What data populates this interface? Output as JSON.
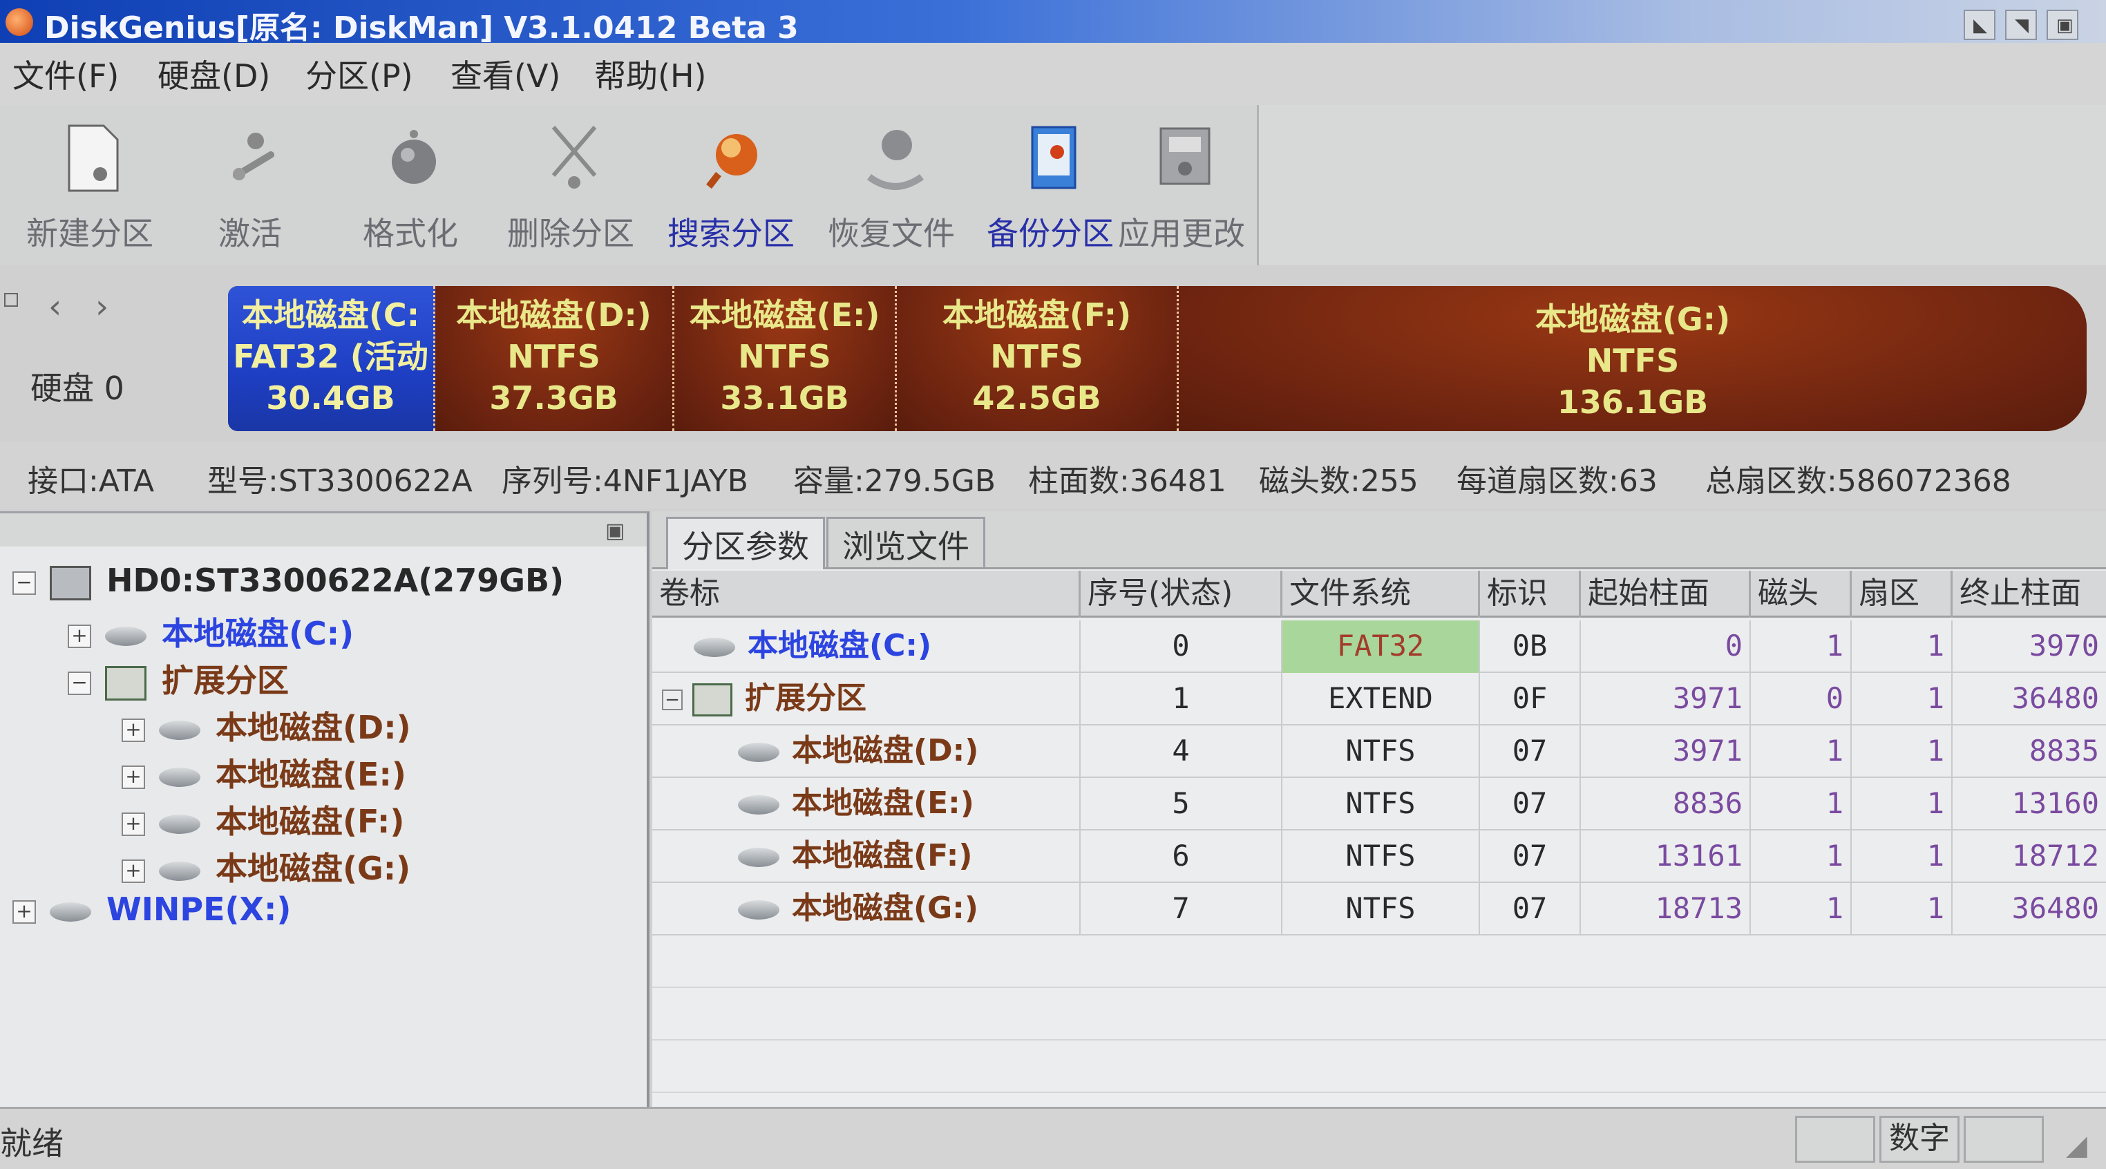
{
  "window": {
    "title": "DiskGenius[原名: DiskMan] V3.1.0412 Beta 3"
  },
  "menu": [
    "文件(F)",
    "硬盘(D)",
    "分区(P)",
    "查看(V)",
    "帮助(H)"
  ],
  "toolbar": [
    {
      "label": "新建分区",
      "icon": "new-partition-icon"
    },
    {
      "label": "激活",
      "icon": "activate-icon"
    },
    {
      "label": "格式化",
      "icon": "format-icon"
    },
    {
      "label": "删除分区",
      "icon": "delete-partition-icon"
    },
    {
      "label": "搜索分区",
      "icon": "search-partition-icon"
    },
    {
      "label": "恢复文件",
      "icon": "recover-files-icon"
    },
    {
      "label": "备份分区",
      "icon": "backup-partition-icon"
    },
    {
      "label": "应用更改",
      "icon": "apply-changes-icon"
    }
  ],
  "diskbar": {
    "disk_label": "硬盘 0",
    "partitions": [
      {
        "name": "本地磁盘(C:",
        "fs": "FAT32 (活动",
        "size": "30.4GB"
      },
      {
        "name": "本地磁盘(D:)",
        "fs": "NTFS",
        "size": "37.3GB"
      },
      {
        "name": "本地磁盘(E:)",
        "fs": "NTFS",
        "size": "33.1GB"
      },
      {
        "name": "本地磁盘(F:)",
        "fs": "NTFS",
        "size": "42.5GB"
      },
      {
        "name": "本地磁盘(G:)",
        "fs": "NTFS",
        "size": "136.1GB"
      }
    ]
  },
  "diskinfo": {
    "interface": "接口:ATA",
    "model": "型号:ST3300622A",
    "serial": "序列号:4NF1JAYB",
    "capacity": "容量:279.5GB",
    "cylinders": "柱面数:36481",
    "heads": "磁头数:255",
    "sectors_per_track": "每道扇区数:63",
    "total_sectors": "总扇区数:586072368"
  },
  "tree": {
    "root": "HD0:ST3300622A(279GB)",
    "c_drive": "本地磁盘(C:)",
    "extended": "扩展分区",
    "d_drive": "本地磁盘(D:)",
    "e_drive": "本地磁盘(E:)",
    "f_drive": "本地磁盘(F:)",
    "g_drive": "本地磁盘(G:)",
    "winpe": "WINPE(X:)"
  },
  "tabs": [
    "分区参数",
    "浏览文件"
  ],
  "table": {
    "columns": [
      "卷标",
      "序号(状态)",
      "文件系统",
      "标识",
      "起始柱面",
      "磁头",
      "扇区",
      "终止柱面"
    ],
    "rows": [
      {
        "name": "本地磁盘(C:)",
        "index": "0",
        "fs": "FAT32",
        "id": "0B",
        "start_cyl": "0",
        "head": "1",
        "sector": "1",
        "end_cyl": "3970"
      },
      {
        "name": "扩展分区",
        "index": "1",
        "fs": "EXTEND",
        "id": "0F",
        "start_cyl": "3971",
        "head": "0",
        "sector": "1",
        "end_cyl": "36480"
      },
      {
        "name": "本地磁盘(D:)",
        "index": "4",
        "fs": "NTFS",
        "id": "07",
        "start_cyl": "3971",
        "head": "1",
        "sector": "1",
        "end_cyl": "8835"
      },
      {
        "name": "本地磁盘(E:)",
        "index": "5",
        "fs": "NTFS",
        "id": "07",
        "start_cyl": "8836",
        "head": "1",
        "sector": "1",
        "end_cyl": "13160"
      },
      {
        "name": "本地磁盘(F:)",
        "index": "6",
        "fs": "NTFS",
        "id": "07",
        "start_cyl": "13161",
        "head": "1",
        "sector": "1",
        "end_cyl": "18712"
      },
      {
        "name": "本地磁盘(G:)",
        "index": "7",
        "fs": "NTFS",
        "id": "07",
        "start_cyl": "18713",
        "head": "1",
        "sector": "1",
        "end_cyl": "36480"
      }
    ]
  },
  "status": {
    "text": "就绪",
    "num_indicator": "数字"
  },
  "colors": {
    "primary_partition": "#1e3fc4",
    "logical_partition": "#6d2410",
    "partition_text": "#e8e88a",
    "tree_blue": "#2c44e0",
    "tree_brown": "#7a3a18",
    "fat32_cell": "#a9d69a"
  }
}
